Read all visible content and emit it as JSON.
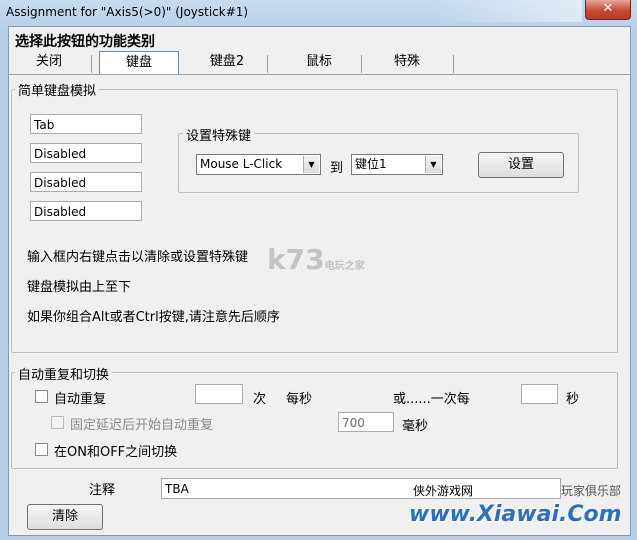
{
  "window": {
    "title": "Assignment for \"Axis5(>0)\" (Joystick#1)",
    "close_glyph": "✕"
  },
  "heading": "选择此按钮的功能类别",
  "tabs": [
    "关闭",
    "键盘",
    "键盘2",
    "鼠标",
    "特殊"
  ],
  "keyboard_group": {
    "label": "简单键盘模拟",
    "keys": [
      "Tab",
      "Disabled",
      "Disabled",
      "Disabled"
    ],
    "special_key_group": {
      "label": "设置特殊键",
      "source_value": "Mouse L-Click",
      "to_label": "到",
      "target_value": "键位1",
      "set_button": "设置"
    },
    "hints": [
      "输入框内右键点击以清除或设置特殊键",
      "键盘模拟由上至下",
      "如果你组合Alt或者Ctrl按键,请注意先后顺序"
    ]
  },
  "repeat_group": {
    "label": "自动重复和切换",
    "auto_repeat": "自动重复",
    "times_value": "",
    "times_unit": "次",
    "per_second": "每秒",
    "or_once_every": "或......一次每",
    "seconds_value": "",
    "seconds_unit": "秒",
    "delay_label": "固定延迟后开始自动重复",
    "delay_value": "700",
    "delay_unit": "毫秒",
    "toggle_label": "在ON和OFF之间切换"
  },
  "notes": {
    "label": "注释",
    "value": "TBA"
  },
  "clear_button": "清除",
  "watermarks": {
    "site1": "k73",
    "site1_sub": "电玩之家",
    "site2_text": "侠外游戏网",
    "site2_url": "www.Xiawai.Com",
    "site2_sub": "玩家俱乐部"
  }
}
